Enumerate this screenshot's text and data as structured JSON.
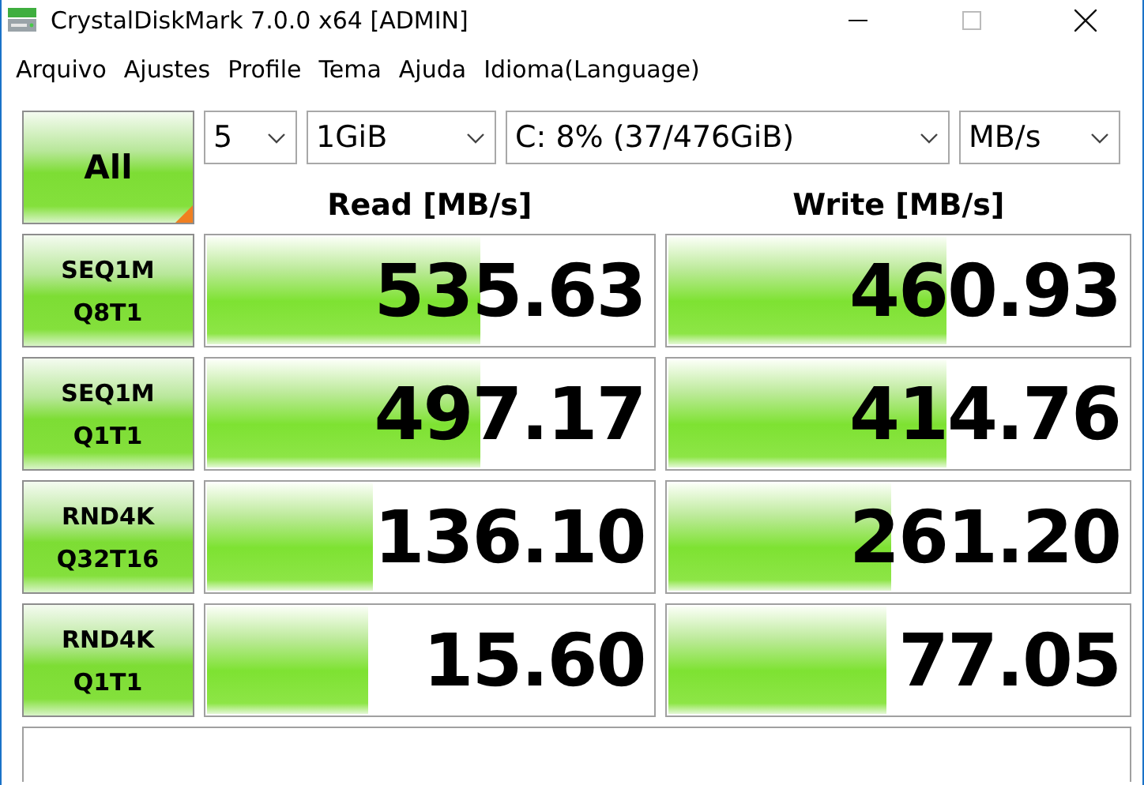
{
  "window": {
    "title": "CrystalDiskMark 7.0.0 x64 [ADMIN]"
  },
  "menu": [
    "Arquivo",
    "Ajustes",
    "Profile",
    "Tema",
    "Ajuda",
    "Idioma(Language)"
  ],
  "all_button": "All",
  "selectors": [
    {
      "value": "5"
    },
    {
      "value": "1GiB"
    },
    {
      "value": "C: 8% (37/476GiB)"
    },
    {
      "value": "MB/s"
    }
  ],
  "columns": [
    "Read [MB/s]",
    "Write [MB/s]"
  ],
  "tests": [
    {
      "line1": "SEQ1M",
      "line2": "Q8T1",
      "read": {
        "value": "535.63",
        "level": 0.61
      },
      "write": {
        "value": "460.93",
        "level": 0.6
      }
    },
    {
      "line1": "SEQ1M",
      "line2": "Q1T1",
      "read": {
        "value": "497.17",
        "level": 0.61
      },
      "write": {
        "value": "414.76",
        "level": 0.6
      }
    },
    {
      "line1": "RND4K",
      "line2": "Q32T16",
      "read": {
        "value": "136.10",
        "level": 0.37
      },
      "write": {
        "value": "261.20",
        "level": 0.48
      }
    },
    {
      "line1": "RND4K",
      "line2": "Q1T1",
      "read": {
        "value": "15.60",
        "level": 0.36
      },
      "write": {
        "value": "77.05",
        "level": 0.47
      }
    }
  ]
}
